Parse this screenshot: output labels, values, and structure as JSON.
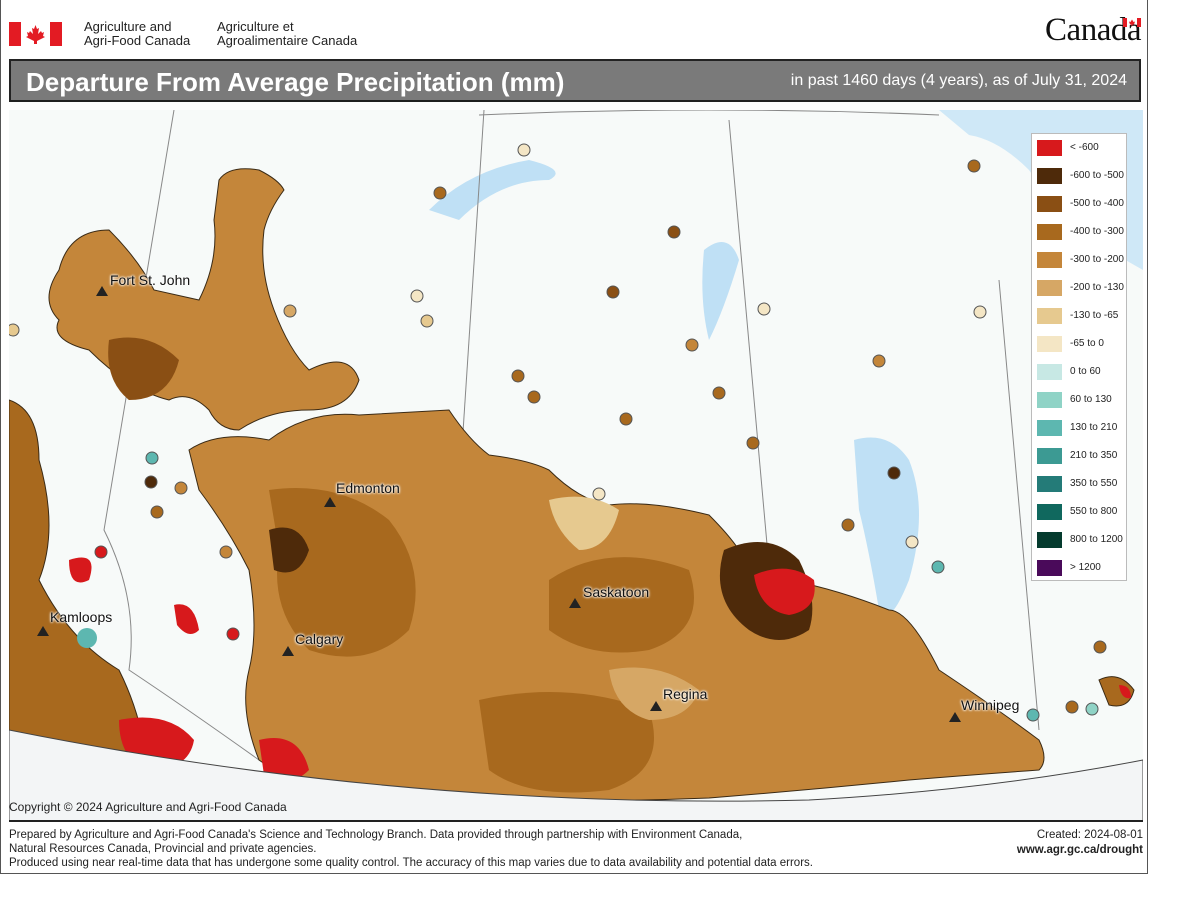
{
  "header": {
    "org_en_line1": "Agriculture and",
    "org_en_line2": "Agri-Food Canada",
    "org_fr_line1": "Agriculture et",
    "org_fr_line2": "Agroalimentaire Canada",
    "wordmark": "Canada",
    "flag_icon": "canada-flag-icon"
  },
  "titlebar": {
    "title": "Departure From Average Precipitation (mm)",
    "subtitle": "in past 1460 days (4 years), as of July 31, 2024"
  },
  "map": {
    "cities": [
      {
        "name": "Fort St. John"
      },
      {
        "name": "Edmonton"
      },
      {
        "name": "Kamloops"
      },
      {
        "name": "Calgary"
      },
      {
        "name": "Saskatoon"
      },
      {
        "name": "Regina"
      },
      {
        "name": "Winnipeg"
      }
    ],
    "copyright": "Copyright © 2024 Agriculture and Agri-Food Canada"
  },
  "legend": {
    "items": [
      {
        "label": "< -600",
        "color": "#d7191c"
      },
      {
        "label": "-600 to -500",
        "color": "#4e2a0a"
      },
      {
        "label": "-500 to -400",
        "color": "#8a4f14"
      },
      {
        "label": "-400 to -300",
        "color": "#a8691e"
      },
      {
        "label": "-300 to -200",
        "color": "#c4863a"
      },
      {
        "label": "-200 to -130",
        "color": "#d6a765"
      },
      {
        "label": "-130 to -65",
        "color": "#e6c98f"
      },
      {
        "label": "-65 to 0",
        "color": "#f4e6c5"
      },
      {
        "label": "0 to 60",
        "color": "#c7e8e4"
      },
      {
        "label": "60 to 130",
        "color": "#8fd3c6"
      },
      {
        "label": "130 to 210",
        "color": "#5db7b0"
      },
      {
        "label": "210 to 350",
        "color": "#3c9a93"
      },
      {
        "label": "350 to 550",
        "color": "#247b78"
      },
      {
        "label": "550 to 800",
        "color": "#10685e"
      },
      {
        "label": "800 to 1200",
        "color": "#053b2e"
      },
      {
        "label": "> 1200",
        "color": "#4a0a5a"
      }
    ]
  },
  "footer": {
    "line1": "Prepared by Agriculture and Agri-Food Canada's Science and Technology Branch. Data provided through partnership with Environment Canada,",
    "line2": "Natural Resources Canada, Provincial and private agencies.",
    "line3": "Produced using near real-time data that has undergone some quality control. The accuracy of this map varies due to data availability and potential data errors.",
    "created": "Created: 2024-08-01",
    "url": "www.agr.gc.ca/drought"
  }
}
